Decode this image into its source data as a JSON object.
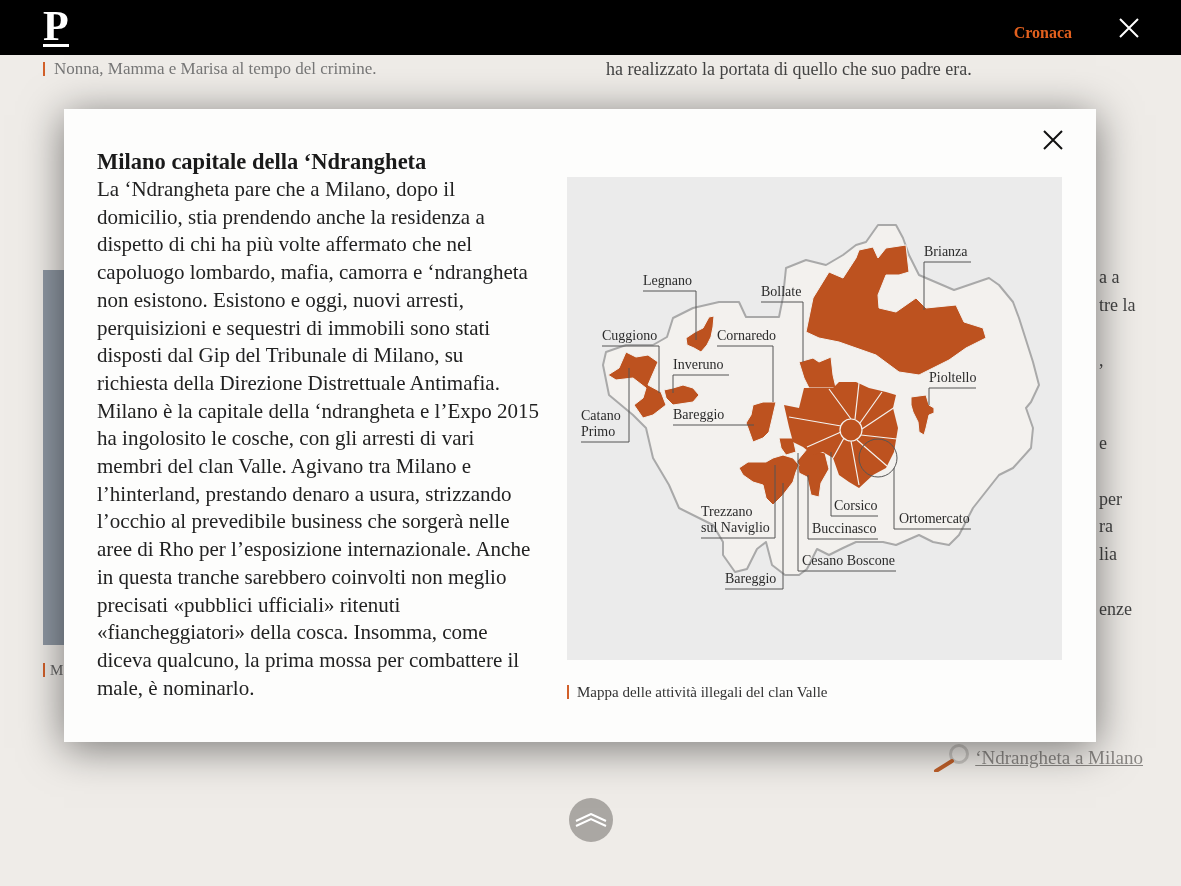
{
  "header": {
    "logo": "P",
    "section_link": "Cronaca"
  },
  "article": {
    "left_caption": "Nonna, Mamma e Marisa al tempo del crimine.",
    "right_text_line": "ha realizzato la portata di quello che suo padre era.",
    "photo_caption_cut": "M",
    "right_column_fragments": [
      "a a",
      "tre la",
      ",",
      "e",
      "per",
      "ra",
      "lia",
      "enze"
    ],
    "related_link": "‘Ndrangheta a Milano"
  },
  "modal": {
    "title": "Milano capitale della ‘Ndrangheta",
    "body": "La ‘Ndrangheta pare che a Milano, dopo il domicilio, stia prendendo anche la residenza a dispetto di chi ha più volte affermato che nel capoluogo lombardo, mafia, camorra e ‘ndrangheta non esistono. Esistono e oggi, nuovi arresti, perquisizioni e sequestri di immobili sono stati disposti dal Gip del Tribunale di Milano, su richiesta della Direzione Distrettuale Antimafia. Milano è la capitale della ‘ndrangheta e l’Expo 2015 ha ingolosito le cosche, con gli arresti di vari membri del clan Valle. Agivano tra Milano e l’hinterland, prestando denaro a usura, strizzando l’occhio al prevedibile business che sorgerà nelle aree di Rho per l’esposizione internazionale. Anche in questa tranche sarebbero coinvolti non meglio precisati «pubblici ufficiali» ritenuti «fiancheggiatori» della cosca. Insomma, come diceva qualcuno, la prima mossa per combattere il male, è nominarlo.",
    "map": {
      "labels": [
        "Brianza",
        "Legnano",
        "Bollate",
        "Cuggiono",
        "Cornaredo",
        "Inveruno",
        "Pioltello",
        "Bareggio",
        "Catano Primo",
        "Corsico",
        "Trezzano sul Naviglio",
        "Ortomercato",
        "Buccinasco",
        "Cesano Boscone",
        "Bareggio"
      ]
    },
    "map_caption": "Mappa delle attività illegali del clan Valle"
  }
}
